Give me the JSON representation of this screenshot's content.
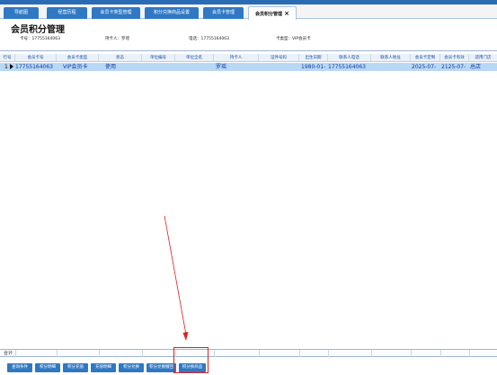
{
  "tabs": [
    {
      "label": "导航图"
    },
    {
      "label": "经营历程"
    },
    {
      "label": "会员卡类型管理"
    },
    {
      "label": "积分兑换商品设置"
    },
    {
      "label": "会员卡管理"
    },
    {
      "label": "会员积分管理",
      "close": "×"
    }
  ],
  "page_title": "会员积分管理",
  "info": {
    "card_no": "卡号：17755164063",
    "holder": "持卡人：罗瑶",
    "phone": "电话：17755164063",
    "card_type": "卡类型：VIP会员卡"
  },
  "grid": {
    "headers": [
      "行号",
      "会员卡号",
      "会员卡类型",
      "状态",
      "单位编号",
      "单位全名",
      "持卡人",
      "证件号码",
      "出生日期",
      "联系人电话",
      "联系人地址",
      "会员卡定制",
      "会员卡有效",
      "适用门店"
    ],
    "rows": [
      {
        "row_no": "1",
        "card_no": "17755164063",
        "card_type": "VIP会员卡",
        "status": "使用",
        "holder": "罗瑶",
        "birth": "1980-01-",
        "contact_phone": "17755164063",
        "custom_date": "2025-07-",
        "valid_until": "2125-07-",
        "store": "总店"
      }
    ],
    "total_label": "合计"
  },
  "buttons": [
    {
      "label": "查询条件"
    },
    {
      "label": "积分明细"
    },
    {
      "label": "积分充值"
    },
    {
      "label": "充值明细"
    },
    {
      "label": "积分兑换"
    },
    {
      "label": "积分兑换撤回"
    },
    {
      "label": "积分换商品"
    }
  ],
  "colors": {
    "accent": "#2f78c4",
    "selected_row": "#b9d8f6",
    "highlight": "#e02020"
  }
}
